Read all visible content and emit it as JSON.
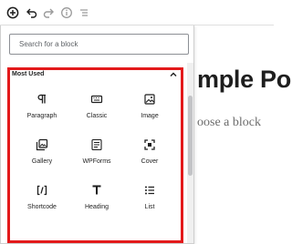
{
  "toolbar": {
    "items": [
      {
        "name": "add-block-icon"
      },
      {
        "name": "undo-icon"
      },
      {
        "name": "redo-icon"
      },
      {
        "name": "info-icon"
      },
      {
        "name": "list-view-icon"
      }
    ]
  },
  "inserter": {
    "search_placeholder": "Search for a block",
    "section_title": "Most Used",
    "blocks": [
      {
        "label": "Paragraph",
        "icon": "paragraph-icon"
      },
      {
        "label": "Classic",
        "icon": "keyboard-icon"
      },
      {
        "label": "Image",
        "icon": "image-icon"
      },
      {
        "label": "Gallery",
        "icon": "gallery-icon"
      },
      {
        "label": "WPForms",
        "icon": "wpforms-icon"
      },
      {
        "label": "Cover",
        "icon": "cover-icon"
      },
      {
        "label": "Shortcode",
        "icon": "shortcode-icon"
      },
      {
        "label": "Heading",
        "icon": "heading-icon"
      },
      {
        "label": "List",
        "icon": "list-icon"
      }
    ]
  },
  "editor": {
    "title_fragment": "mple Po",
    "prompt_fragment": "oose a block"
  },
  "colors": {
    "highlight": "#e3191b",
    "icon": "#1e1e1e"
  }
}
